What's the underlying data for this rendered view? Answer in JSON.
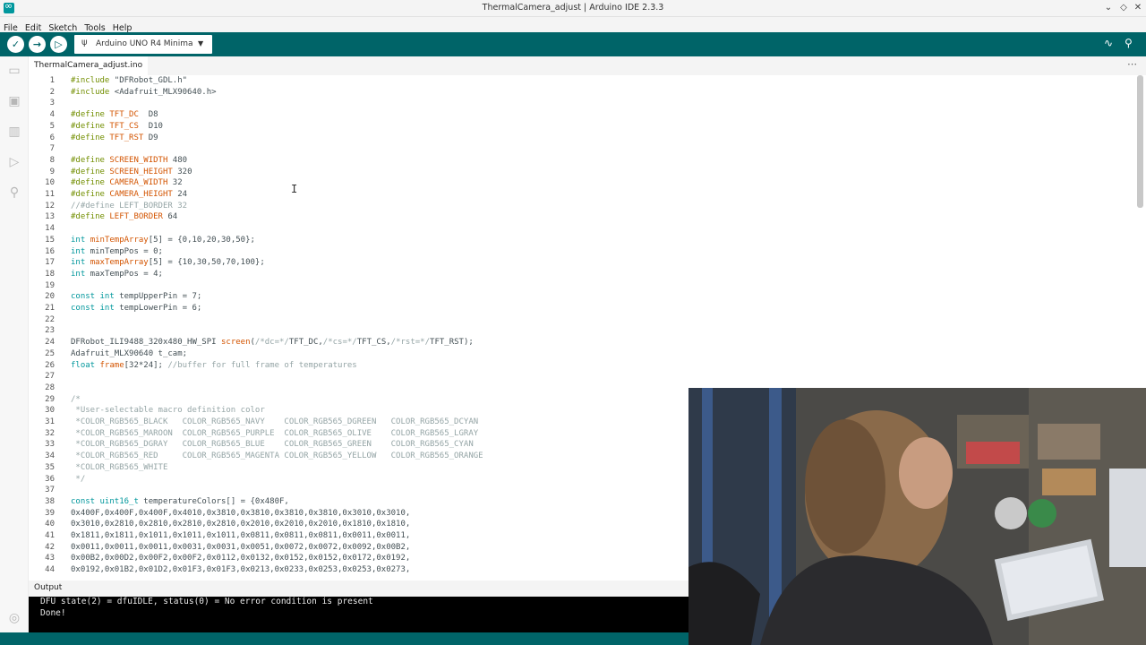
{
  "window": {
    "title": "ThermalCamera_adjust | Arduino IDE 2.3.3"
  },
  "menu": [
    "File",
    "Edit",
    "Sketch",
    "Tools",
    "Help"
  ],
  "toolbar": {
    "board_name": "Arduino UNO R4 Minima"
  },
  "tab": {
    "label": "ThermalCamera_adjust.ino"
  },
  "code_lines": [
    {
      "n": "1",
      "html": "<span class='kw2'>#include</span> \"DFRobot_GDL.h\""
    },
    {
      "n": "2",
      "html": "<span class='kw2'>#include</span> &lt;Adafruit_MLX90640.h&gt;"
    },
    {
      "n": "3",
      "html": ""
    },
    {
      "n": "4",
      "html": "<span class='kw2'>#define</span> <span class='mac'>TFT_DC</span>  D8"
    },
    {
      "n": "5",
      "html": "<span class='kw2'>#define</span> <span class='mac'>TFT_CS</span>  D10"
    },
    {
      "n": "6",
      "html": "<span class='kw2'>#define</span> <span class='mac'>TFT_RST</span> D9"
    },
    {
      "n": "7",
      "html": ""
    },
    {
      "n": "8",
      "html": "<span class='kw2'>#define</span> <span class='mac'>SCREEN_WIDTH</span> 480"
    },
    {
      "n": "9",
      "html": "<span class='kw2'>#define</span> <span class='mac'>SCREEN_HEIGHT</span> 320"
    },
    {
      "n": "10",
      "html": "<span class='kw2'>#define</span> <span class='mac'>CAMERA_WIDTH</span> 32"
    },
    {
      "n": "11",
      "html": "<span class='kw2'>#define</span> <span class='mac'>CAMERA_HEIGHT</span> 24"
    },
    {
      "n": "12",
      "html": "<span class='cm'>//#define LEFT_BORDER 32</span>"
    },
    {
      "n": "13",
      "html": "<span class='kw2'>#define</span> <span class='mac'>LEFT_BORDER</span> 64"
    },
    {
      "n": "14",
      "html": ""
    },
    {
      "n": "15",
      "html": "<span class='kw'>int</span> <span class='mac'>minTempArray</span>[5] = {0,10,20,30,50};"
    },
    {
      "n": "16",
      "html": "<span class='kw'>int</span> minTempPos = 0;"
    },
    {
      "n": "17",
      "html": "<span class='kw'>int</span> <span class='mac'>maxTempArray</span>[5] = {10,30,50,70,100};"
    },
    {
      "n": "18",
      "html": "<span class='kw'>int</span> maxTempPos = 4;"
    },
    {
      "n": "19",
      "html": ""
    },
    {
      "n": "20",
      "html": "<span class='kw'>const</span> <span class='kw'>int</span> tempUpperPin = 7;"
    },
    {
      "n": "21",
      "html": "<span class='kw'>const</span> <span class='kw'>int</span> tempLowerPin = 6;"
    },
    {
      "n": "22",
      "html": ""
    },
    {
      "n": "23",
      "html": ""
    },
    {
      "n": "24",
      "html": "DFRobot_ILI9488_320x480_HW_SPI <span class='mac'>screen</span>(<span class='cm'>/*dc=*/</span>TFT_DC,<span class='cm'>/*cs=*/</span>TFT_CS,<span class='cm'>/*rst=*/</span>TFT_RST);"
    },
    {
      "n": "25",
      "html": "Adafruit_MLX90640 t_cam;"
    },
    {
      "n": "26",
      "html": "<span class='kw'>float</span> <span class='mac'>frame</span>[32*24]; <span class='cm'>//buffer for full frame of temperatures</span>"
    },
    {
      "n": "27",
      "html": ""
    },
    {
      "n": "28",
      "html": ""
    },
    {
      "n": "29",
      "html": "<span class='cm'>/*</span>"
    },
    {
      "n": "30",
      "html": "<span class='cm'> *User-selectable macro definition color</span>"
    },
    {
      "n": "31",
      "html": "<span class='cm'> *COLOR_RGB565_BLACK   COLOR_RGB565_NAVY    COLOR_RGB565_DGREEN   COLOR_RGB565_DCYAN</span>"
    },
    {
      "n": "32",
      "html": "<span class='cm'> *COLOR_RGB565_MAROON  COLOR_RGB565_PURPLE  COLOR_RGB565_OLIVE    COLOR_RGB565_LGRAY</span>"
    },
    {
      "n": "33",
      "html": "<span class='cm'> *COLOR_RGB565_DGRAY   COLOR_RGB565_BLUE    COLOR_RGB565_GREEN    COLOR_RGB565_CYAN</span>"
    },
    {
      "n": "34",
      "html": "<span class='cm'> *COLOR_RGB565_RED     COLOR_RGB565_MAGENTA COLOR_RGB565_YELLOW   COLOR_RGB565_ORANGE</span>"
    },
    {
      "n": "35",
      "html": "<span class='cm'> *COLOR_RGB565_WHITE</span>"
    },
    {
      "n": "36",
      "html": "<span class='cm'> */</span>"
    },
    {
      "n": "37",
      "html": ""
    },
    {
      "n": "38",
      "html": "<span class='kw'>const</span> <span class='kw'>uint16_t</span> temperatureColors[] = {0x480F,"
    },
    {
      "n": "39",
      "html": "0x400F,0x400F,0x400F,0x4010,0x3810,0x3810,0x3810,0x3810,0x3010,0x3010,"
    },
    {
      "n": "40",
      "html": "0x3010,0x2810,0x2810,0x2810,0x2810,0x2010,0x2010,0x2010,0x1810,0x1810,"
    },
    {
      "n": "41",
      "html": "0x1811,0x1811,0x1011,0x1011,0x1011,0x0811,0x0811,0x0811,0x0011,0x0011,"
    },
    {
      "n": "42",
      "html": "0x0011,0x0011,0x0011,0x0031,0x0031,0x0051,0x0072,0x0072,0x0092,0x00B2,"
    },
    {
      "n": "43",
      "html": "0x00B2,0x00D2,0x00F2,0x00F2,0x0112,0x0132,0x0152,0x0152,0x0172,0x0192,"
    },
    {
      "n": "44",
      "html": "0x0192,0x01B2,0x01D2,0x01F3,0x01F3,0x0213,0x0233,0x0253,0x0253,0x0273,"
    }
  ],
  "output": {
    "label": "Output",
    "lines": [
      "DFU state(2) = dfuIDLE, status(0) = No error condition is present",
      "Done!"
    ]
  },
  "icons": {
    "verify": "check-icon",
    "upload": "arrow-right-icon",
    "debug": "debug-icon",
    "serial_plotter": "plotter-icon",
    "serial_monitor": "monitor-icon"
  }
}
